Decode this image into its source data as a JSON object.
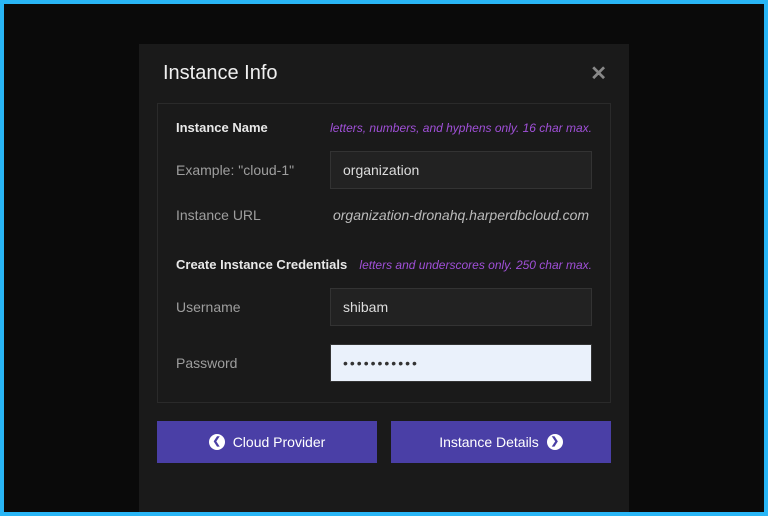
{
  "modal": {
    "title": "Instance Info"
  },
  "instance": {
    "section_title": "Instance Name",
    "hint": "letters, numbers, and hyphens only. 16 char max.",
    "example_label": "Example: \"cloud-1\"",
    "name_value": "organization",
    "url_label": "Instance URL",
    "url_value": "organization-dronahq.harperdbcloud.com"
  },
  "credentials": {
    "section_title": "Create Instance Credentials",
    "hint": "letters and underscores only. 250 char max.",
    "username_label": "Username",
    "username_value": "shibam",
    "password_label": "Password",
    "password_value": "•••••••••••"
  },
  "footer": {
    "back_label": "Cloud Provider",
    "next_label": "Instance Details"
  }
}
